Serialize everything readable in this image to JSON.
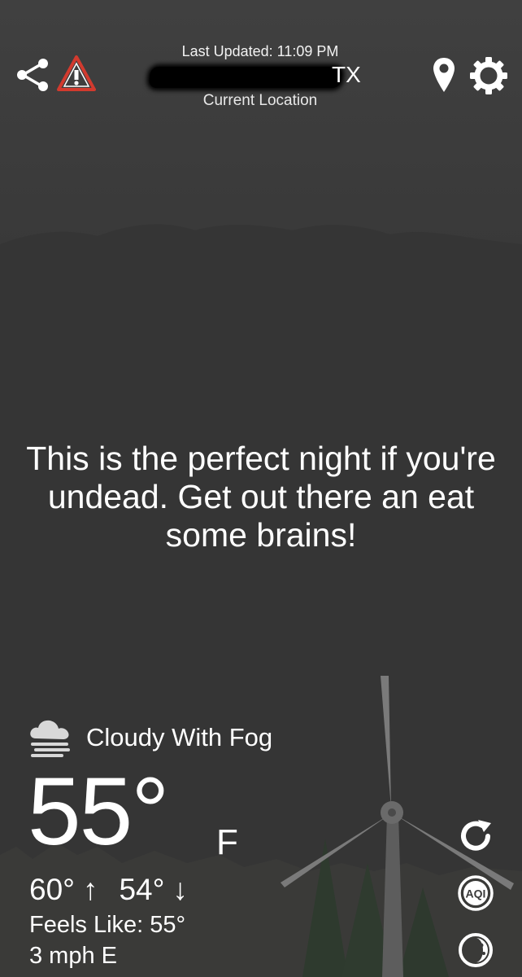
{
  "header": {
    "last_updated": "Last Updated: 11:09 PM",
    "location_state": "TX",
    "location_subtitle": "Current Location"
  },
  "message": "This is the perfect night if you're undead. Get out there an eat some brains!",
  "weather": {
    "condition": "Cloudy With Fog",
    "condition_icon": "cloud-fog-icon",
    "temperature": "55°",
    "unit": "F",
    "high": "60°",
    "high_arrow": "↑",
    "low": "54°",
    "low_arrow": "↓",
    "feels_like": "Feels Like: 55°",
    "wind": "3 mph E"
  },
  "actions": {
    "aqi_label": "AQI"
  },
  "icons": [
    "share-icon",
    "alert-triangle-icon",
    "location-pin-icon",
    "settings-gear-icon",
    "refresh-icon",
    "aqi-icon",
    "moon-phase-icon"
  ],
  "colors": {
    "alert_red": "#d23a2e",
    "background": "#3a3a3a",
    "text": "#ffffff"
  }
}
